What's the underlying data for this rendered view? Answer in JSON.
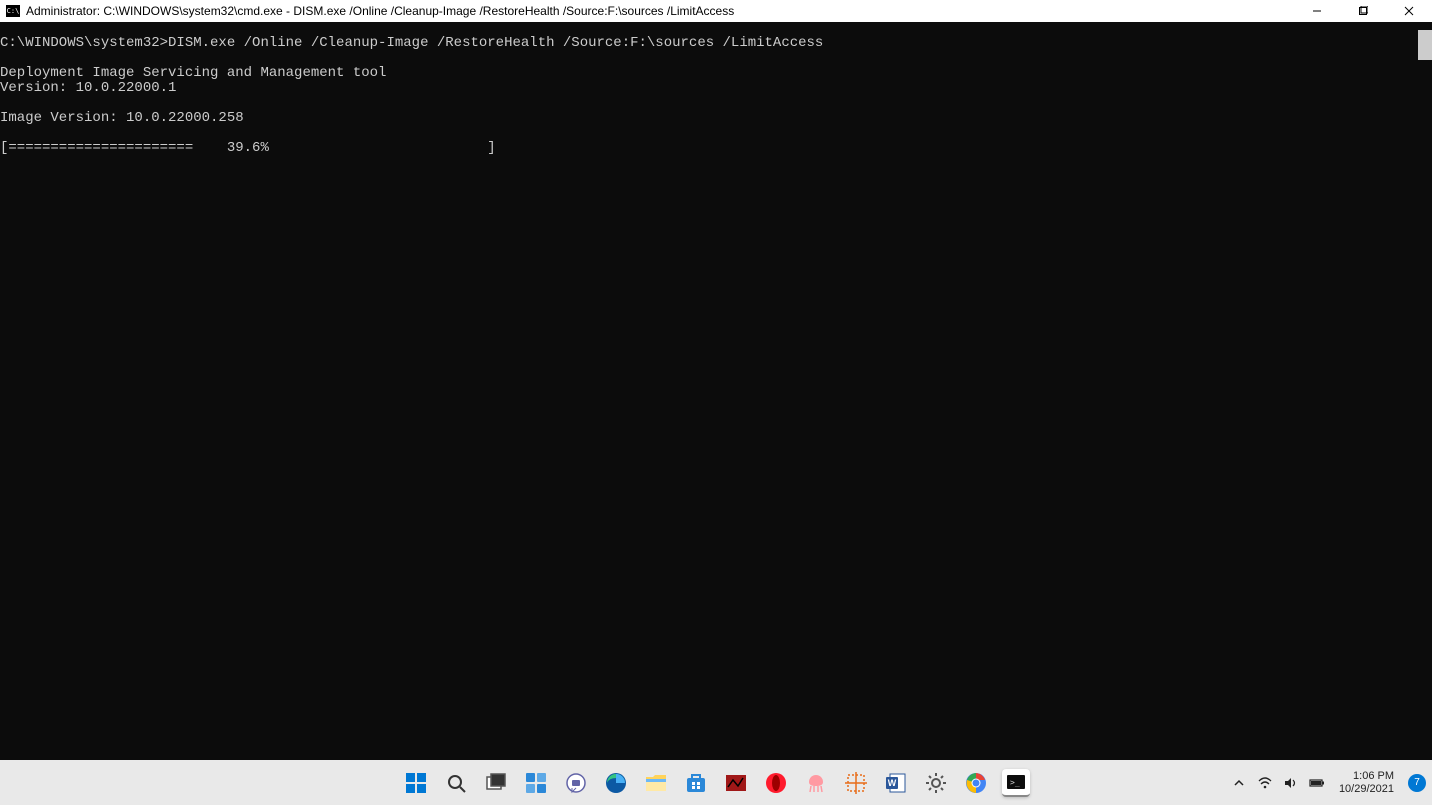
{
  "titlebar": {
    "icon_label": "C:\\",
    "title": "Administrator: C:\\WINDOWS\\system32\\cmd.exe - DISM.exe  /Online /Cleanup-Image /RestoreHealth /Source:F:\\sources /LimitAccess"
  },
  "terminal": {
    "prompt_line": "C:\\WINDOWS\\system32>DISM.exe /Online /Cleanup-Image /RestoreHealth /Source:F:\\sources /LimitAccess",
    "tool_header": "Deployment Image Servicing and Management tool",
    "version_line": "Version: 10.0.22000.1",
    "image_version_line": "Image Version: 10.0.22000.258",
    "progress_line": "[======================    39.6%                          ]"
  },
  "taskbar": {
    "icons": [
      {
        "name": "start-icon"
      },
      {
        "name": "search-icon"
      },
      {
        "name": "taskview-icon"
      },
      {
        "name": "widgets-icon"
      },
      {
        "name": "chat-icon"
      },
      {
        "name": "edge-icon"
      },
      {
        "name": "fileexplorer-icon"
      },
      {
        "name": "store-icon"
      },
      {
        "name": "redsquare-icon"
      },
      {
        "name": "opera-icon"
      },
      {
        "name": "jellyfish-icon"
      },
      {
        "name": "snip-icon"
      },
      {
        "name": "word-icon"
      },
      {
        "name": "settings-icon"
      },
      {
        "name": "chrome-icon"
      },
      {
        "name": "terminal-icon"
      }
    ]
  },
  "systray": {
    "time": "1:06 PM",
    "date": "10/29/2021",
    "notification_count": "7"
  }
}
